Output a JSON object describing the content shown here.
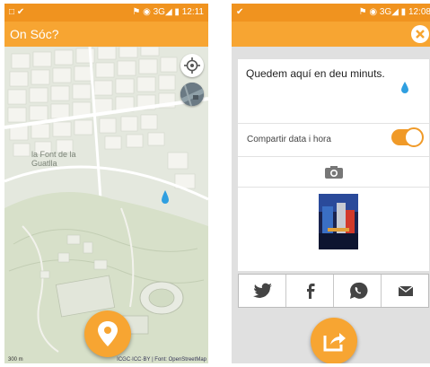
{
  "left_screen": {
    "status_bar": {
      "left_icons": "□ ✔",
      "right_text": "⚑ ◉ 3G◢ ▮ 12:11"
    },
    "app_bar": {
      "title": "On Sóc?"
    },
    "map": {
      "area_label": "la Font de la Guatlla",
      "scale_text": "300 m",
      "attribution": "ICGC·ICC·BY | Font: OpenStreetMap"
    },
    "icons": {
      "locate": "crosshair-icon",
      "layers": "satellite-layer-icon",
      "fab": "map-pin-icon",
      "marker": "location-drop-icon"
    }
  },
  "right_screen": {
    "status_bar": {
      "left_icons": "✔",
      "right_text": "⚑ ◉ 3G◢ ▮ 12:08"
    },
    "message_text": "Quedem aquí en deu minuts.",
    "share_datetime_label": "Compartir data i hora",
    "share_datetime_on": true,
    "social_buttons": [
      "twitter-icon",
      "facebook-icon",
      "whatsapp-icon",
      "email-icon"
    ],
    "icons": {
      "close": "close-icon",
      "camera": "camera-icon",
      "fab": "share-icon"
    }
  },
  "colors": {
    "accent": "#f7a532",
    "status_bar": "#f0931f",
    "marker": "#2f9fe0"
  }
}
